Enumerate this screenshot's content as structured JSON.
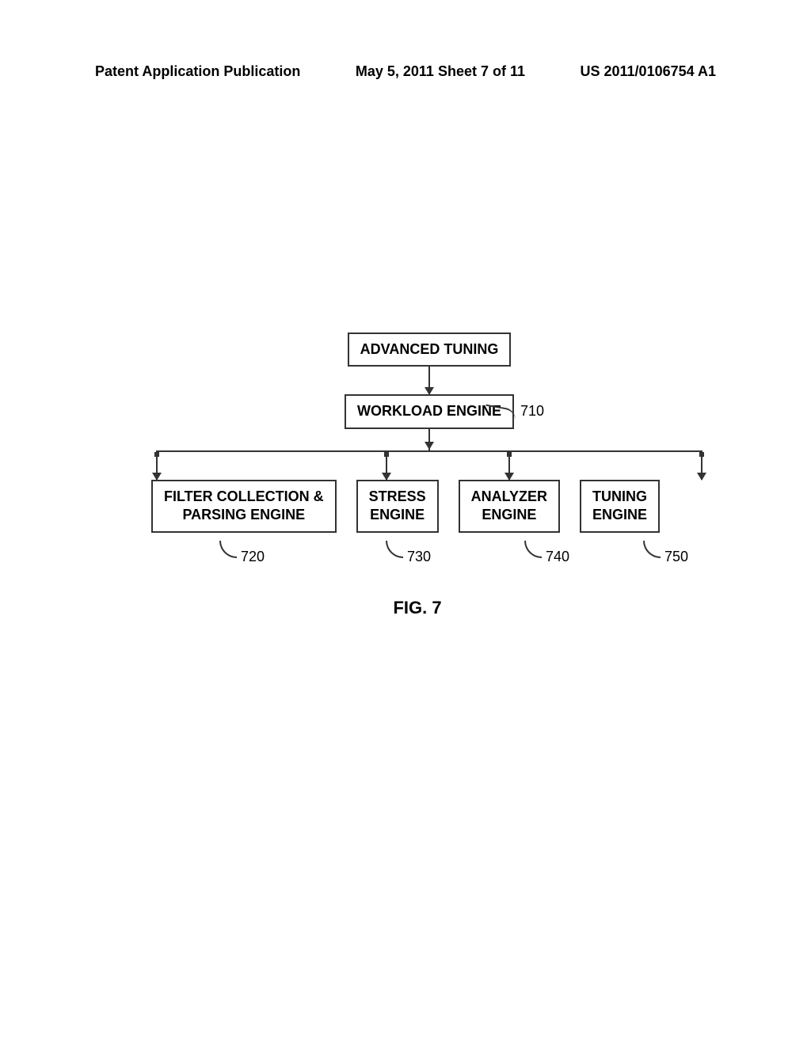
{
  "header": {
    "left": "Patent Application Publication",
    "center": "May 5, 2011  Sheet 7 of 11",
    "right": "US 2011/0106754 A1"
  },
  "diagram": {
    "top_box": "ADVANCED TUNING",
    "workload_box": "WORKLOAD ENGINE",
    "ref_710": "710",
    "boxes": {
      "filter": "FILTER COLLECTION &\nPARSING ENGINE",
      "stress": "STRESS\nENGINE",
      "analyzer": "ANALYZER\nENGINE",
      "tuning": "TUNING\nENGINE"
    },
    "refs": {
      "r720": "720",
      "r730": "730",
      "r740": "740",
      "r750": "750"
    }
  },
  "figure_label": "FIG. 7"
}
